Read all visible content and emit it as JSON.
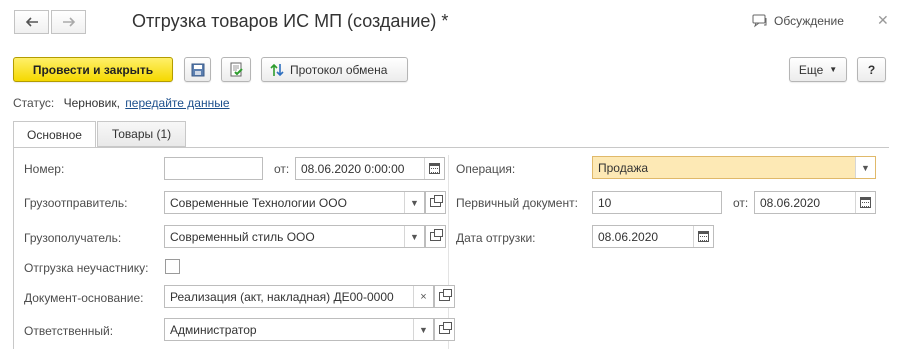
{
  "window": {
    "title": "Отгрузка товаров ИС МП (создание) *",
    "discussion_label": "Обсуждение",
    "close_glyph": "✕"
  },
  "nav": {
    "back_glyph": "🡐",
    "forward_glyph": "🡒"
  },
  "toolbar": {
    "post_close_label": "Провести и закрыть",
    "exchange_log_label": "Протокол обмена",
    "more_label": "Еще",
    "help_label": "?"
  },
  "status": {
    "label": "Статус:",
    "value": "Черновик,",
    "link": "передайте данные"
  },
  "tabs": [
    {
      "label": "Основное"
    },
    {
      "label": "Товары (1)"
    }
  ],
  "form": {
    "number_label": "Номер:",
    "number_value": "",
    "from_label": "от:",
    "date_value": "08.06.2020  0:00:00",
    "shipper_label": "Грузоотправитель:",
    "shipper_value": "Современные Технологии ООО",
    "consignee_label": "Грузополучатель:",
    "consignee_value": "Современный стиль ООО",
    "non_participant_label": "Отгрузка неучастнику:",
    "base_doc_label": "Документ-основание:",
    "base_doc_value": "Реализация (акт, накладная) ДЕ00-0000",
    "responsible_label": "Ответственный:",
    "responsible_value": "Администратор",
    "operation_label": "Операция:",
    "operation_value": "Продажа",
    "primary_doc_label": "Первичный документ:",
    "primary_doc_value": "10",
    "primary_from_label": "от:",
    "primary_date_value": "08.06.2020",
    "ship_date_label": "Дата отгрузки:",
    "ship_date_value": "08.06.2020"
  },
  "colors": {
    "primary_button": "#f5d900",
    "operation_field_bg": "#fde9b5",
    "link": "#1c4f8c"
  }
}
